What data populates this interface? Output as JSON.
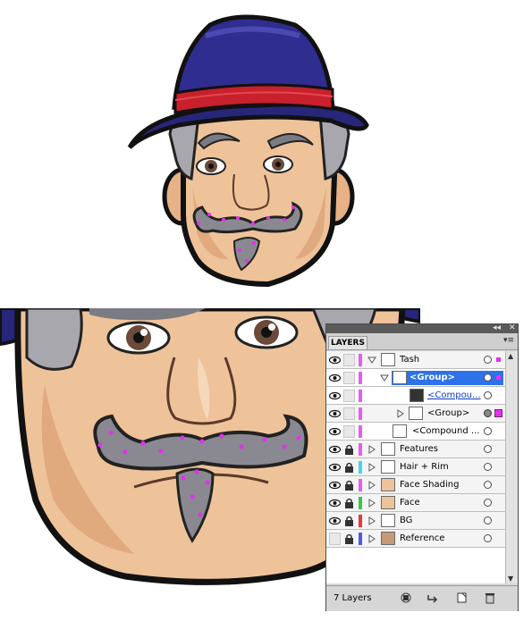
{
  "panel": {
    "tab_label": "LAYERS",
    "collapse_glyph": "◂◂",
    "close_glyph": "✕",
    "menu_glyph": "▾≡",
    "layer_count": "7 Layers",
    "layers": [
      {
        "name": "Tash",
        "color": "#e45ef0",
        "expanded": true
      },
      {
        "name": "<Group>",
        "selected": true
      },
      {
        "name": "<Compou..."
      },
      {
        "name": "<Group>"
      },
      {
        "name": "<Compound ..."
      },
      {
        "name": "Features",
        "color": "#e45ef0"
      },
      {
        "name": "Hair + Rim",
        "color": "#45d4ec"
      },
      {
        "name": "Face Shading",
        "color": "#e45ef0"
      },
      {
        "name": "Face",
        "color": "#36c94a"
      },
      {
        "name": "BG",
        "color": "#e23a3a"
      },
      {
        "name": "Reference",
        "color": "#4a5be8"
      }
    ],
    "footer_icons": [
      "make-clipping-mask-icon",
      "create-sublayer-icon",
      "create-new-layer-icon",
      "delete-layer-icon"
    ]
  },
  "colors": {
    "selection": "#2d72e8",
    "anchor_magenta": "#e42ff0",
    "hat": "#2b2a86",
    "hat_band": "#c8202c",
    "skin": "#eec39a",
    "moustache": "#8a8890"
  }
}
